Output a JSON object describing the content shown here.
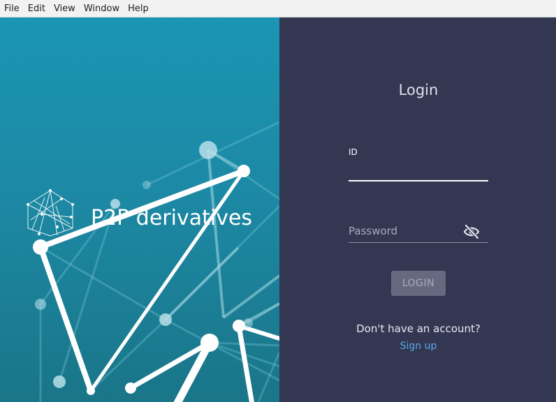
{
  "menubar": {
    "items": [
      "File",
      "Edit",
      "View",
      "Window",
      "Help"
    ]
  },
  "brand": {
    "logo_text": "P2P derivatives"
  },
  "login": {
    "title": "Login",
    "id_label": "ID",
    "id_value": "",
    "password_placeholder": "Password",
    "password_value": "",
    "password_toggle_icon": "eye-off-icon",
    "login_button": "LOGIN",
    "no_account_text": "Don't have an account?",
    "signup_link": "Sign up"
  },
  "colors": {
    "panel_dark": "#333752",
    "brand_teal": "#1a8fae",
    "link_blue": "#5aa7e8",
    "button_disabled": "#666a81"
  }
}
